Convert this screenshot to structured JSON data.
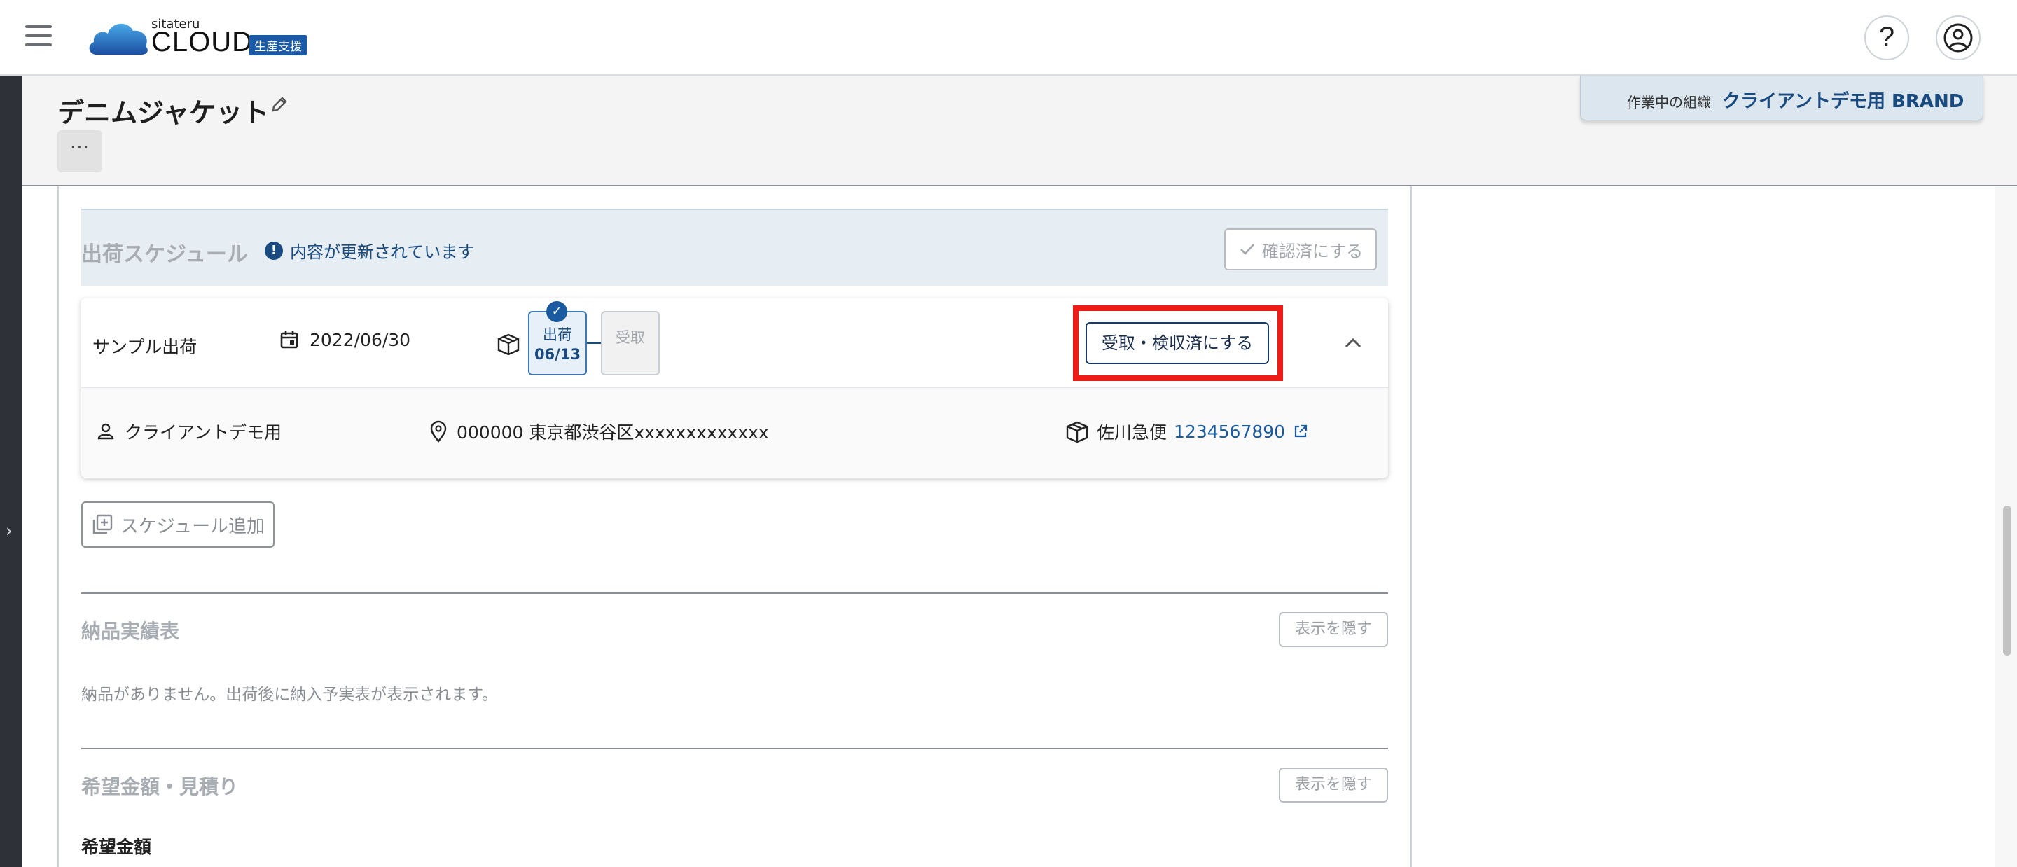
{
  "header": {
    "logo_sub": "sitateru",
    "logo_main": "CLOUD",
    "logo_badge": "生産支援",
    "help_glyph": "?"
  },
  "page": {
    "title": "デニムジャケット",
    "more_label": "···"
  },
  "org": {
    "label": "作業中の組織",
    "name": "クライアントデモ用 BRAND"
  },
  "schedule": {
    "title": "出荷スケジュール",
    "notice": "内容が更新されています",
    "notice_glyph": "!",
    "confirm_label": "確認済にする",
    "item": {
      "name": "サンプル出荷",
      "date": "2022/06/30",
      "step_ship_label": "出荷",
      "step_ship_date": "06/13",
      "step_receive_label": "受取",
      "receive_button": "受取・検収済にする",
      "client": "クライアントデモ用",
      "address": "000000 東京都渋谷区xxxxxxxxxxxxx",
      "carrier": "佐川急便",
      "tracking": "1234567890"
    },
    "add_label": "スケジュール追加"
  },
  "delivery": {
    "title": "納品実績表",
    "hide_label": "表示を隠す",
    "empty_text": "納品がありません。出荷後に納入予実表が表示されます。"
  },
  "estimate": {
    "title": "希望金額・見積り",
    "hide_label": "表示を隠す",
    "sub_title": "希望金額"
  },
  "colors": {
    "brand": "#1a4b80",
    "highlight": "#ee1c16",
    "rail": "#2e3238"
  }
}
